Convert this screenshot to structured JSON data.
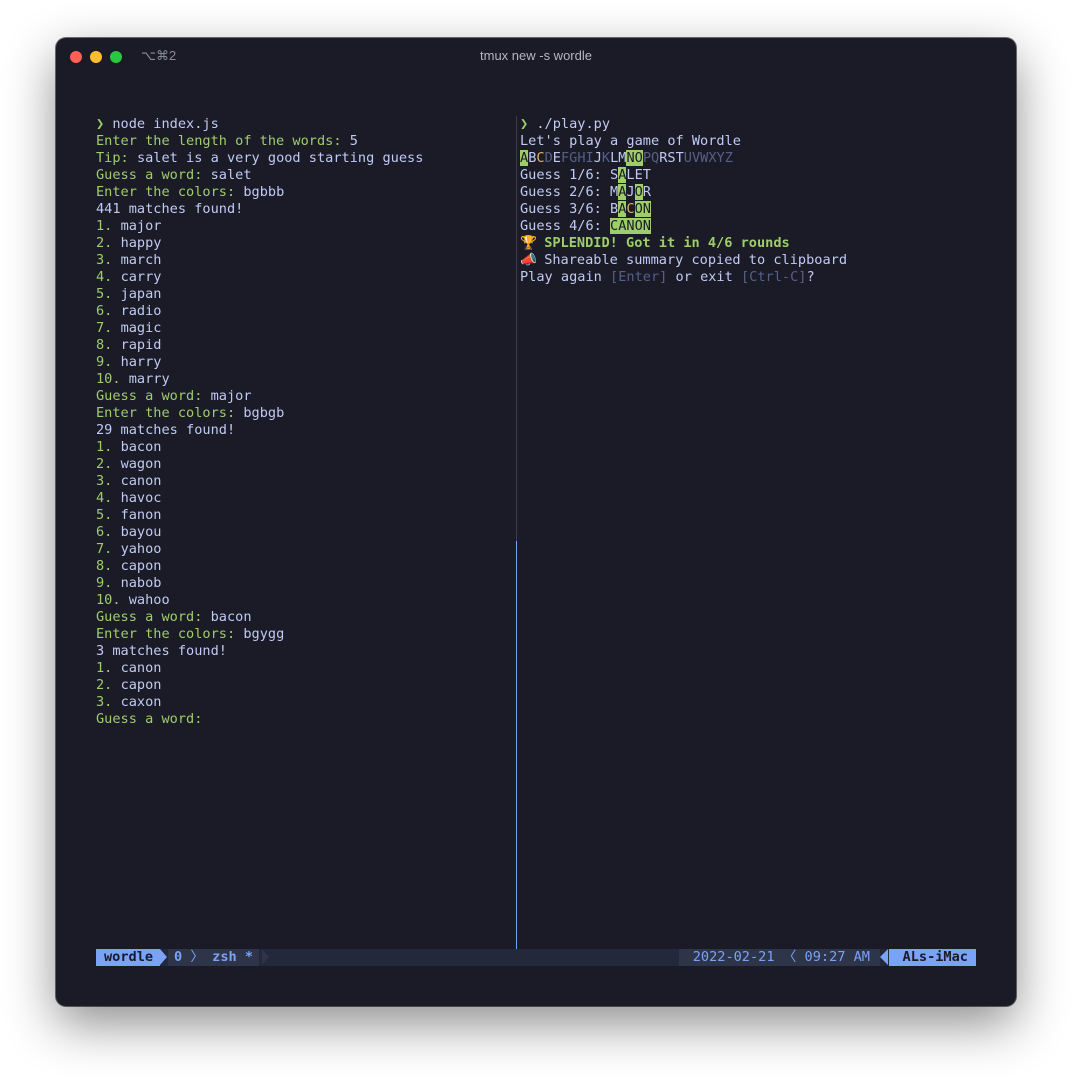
{
  "window": {
    "title": "tmux new -s wordle",
    "shortcut": "⌥⌘2"
  },
  "left_pane": {
    "prompt_symbol": "❯",
    "command": "node index.js",
    "length_label": "Enter the length of the words:",
    "length_value": "5",
    "tip_label": "Tip:",
    "tip_text": "salet is a very good starting guess",
    "rounds": [
      {
        "guess_label": "Guess a word:",
        "guess": "salet",
        "colors_label": "Enter the colors:",
        "colors": "bgbbb",
        "matches": "441 matches found!",
        "results": [
          {
            "n": "1.",
            "word": "major"
          },
          {
            "n": "2.",
            "word": "happy"
          },
          {
            "n": "3.",
            "word": "march"
          },
          {
            "n": "4.",
            "word": "carry"
          },
          {
            "n": "5.",
            "word": "japan"
          },
          {
            "n": "6.",
            "word": "radio"
          },
          {
            "n": "7.",
            "word": "magic"
          },
          {
            "n": "8.",
            "word": "rapid"
          },
          {
            "n": "9.",
            "word": "harry"
          },
          {
            "n": "10.",
            "word": "marry"
          }
        ]
      },
      {
        "guess_label": "Guess a word:",
        "guess": "major",
        "colors_label": "Enter the colors:",
        "colors": "bgbgb",
        "matches": "29 matches found!",
        "results": [
          {
            "n": "1.",
            "word": "bacon"
          },
          {
            "n": "2.",
            "word": "wagon"
          },
          {
            "n": "3.",
            "word": "canon"
          },
          {
            "n": "4.",
            "word": "havoc"
          },
          {
            "n": "5.",
            "word": "fanon"
          },
          {
            "n": "6.",
            "word": "bayou"
          },
          {
            "n": "7.",
            "word": "yahoo"
          },
          {
            "n": "8.",
            "word": "capon"
          },
          {
            "n": "9.",
            "word": "nabob"
          },
          {
            "n": "10.",
            "word": "wahoo"
          }
        ]
      },
      {
        "guess_label": "Guess a word:",
        "guess": "bacon",
        "colors_label": "Enter the colors:",
        "colors": "bgygg",
        "matches": "3 matches found!",
        "results": [
          {
            "n": "1.",
            "word": "canon"
          },
          {
            "n": "2.",
            "word": "capon"
          },
          {
            "n": "3.",
            "word": "caxon"
          }
        ]
      }
    ],
    "final_prompt": "Guess a word:"
  },
  "right_pane": {
    "prompt_symbol": "❯",
    "command": "./play.py",
    "intro": "Let's play a game of Wordle",
    "keyboard": [
      {
        "ch": "A",
        "state": "green"
      },
      {
        "ch": "B",
        "state": "white"
      },
      {
        "ch": "C",
        "state": "yellow"
      },
      {
        "ch": "D",
        "state": "dim"
      },
      {
        "ch": "E",
        "state": "white"
      },
      {
        "ch": "F",
        "state": "dim"
      },
      {
        "ch": "G",
        "state": "dim"
      },
      {
        "ch": "H",
        "state": "dim"
      },
      {
        "ch": "I",
        "state": "dim"
      },
      {
        "ch": "J",
        "state": "white"
      },
      {
        "ch": "K",
        "state": "dim"
      },
      {
        "ch": "L",
        "state": "white"
      },
      {
        "ch": "M",
        "state": "white"
      },
      {
        "ch": "N",
        "state": "green"
      },
      {
        "ch": "O",
        "state": "green"
      },
      {
        "ch": "P",
        "state": "dim"
      },
      {
        "ch": "Q",
        "state": "dim"
      },
      {
        "ch": "R",
        "state": "white"
      },
      {
        "ch": "S",
        "state": "white"
      },
      {
        "ch": "T",
        "state": "white"
      },
      {
        "ch": "U",
        "state": "dim"
      },
      {
        "ch": "V",
        "state": "dim"
      },
      {
        "ch": "W",
        "state": "dim"
      },
      {
        "ch": "X",
        "state": "dim"
      },
      {
        "ch": "Y",
        "state": "dim"
      },
      {
        "ch": "Z",
        "state": "dim"
      }
    ],
    "guesses": [
      {
        "label": "Guess 1/6:",
        "letters": [
          {
            "ch": "S",
            "state": "none"
          },
          {
            "ch": "A",
            "state": "green"
          },
          {
            "ch": "L",
            "state": "none"
          },
          {
            "ch": "E",
            "state": "none"
          },
          {
            "ch": "T",
            "state": "none"
          }
        ]
      },
      {
        "label": "Guess 2/6:",
        "letters": [
          {
            "ch": "M",
            "state": "none"
          },
          {
            "ch": "A",
            "state": "green"
          },
          {
            "ch": "J",
            "state": "none"
          },
          {
            "ch": "O",
            "state": "green"
          },
          {
            "ch": "R",
            "state": "none"
          }
        ]
      },
      {
        "label": "Guess 3/6:",
        "letters": [
          {
            "ch": "B",
            "state": "none"
          },
          {
            "ch": "A",
            "state": "green"
          },
          {
            "ch": "C",
            "state": "yellow"
          },
          {
            "ch": "O",
            "state": "green"
          },
          {
            "ch": "N",
            "state": "green"
          }
        ]
      },
      {
        "label": "Guess 4/6:",
        "letters": [
          {
            "ch": "C",
            "state": "green"
          },
          {
            "ch": "A",
            "state": "green"
          },
          {
            "ch": "N",
            "state": "green"
          },
          {
            "ch": "O",
            "state": "green"
          },
          {
            "ch": "N",
            "state": "green"
          }
        ]
      }
    ],
    "win_icon": "🏆",
    "win_text": "SPLENDID! Got it in 4/6 rounds",
    "share_icon": "📣",
    "share_text": "Shareable summary copied to clipboard",
    "play_again_prefix": "Play again ",
    "enter_hint": "[Enter]",
    "play_again_mid": " or exit ",
    "exit_hint": "[Ctrl-C]",
    "play_again_suffix": "?"
  },
  "statusbar": {
    "session": "wordle",
    "window_index": "0",
    "window_sep": "〉",
    "window_name": "zsh *",
    "date": "2022-02-21",
    "time_sep": "〈",
    "time": "09:27 AM",
    "host": "ALs-iMac"
  },
  "colors": {
    "background": "#1a1b26",
    "green": "#9ece6a",
    "yellow": "#e0af68",
    "blue": "#7aa2f7",
    "text": "#c0caf5",
    "dim": "#565f89"
  }
}
